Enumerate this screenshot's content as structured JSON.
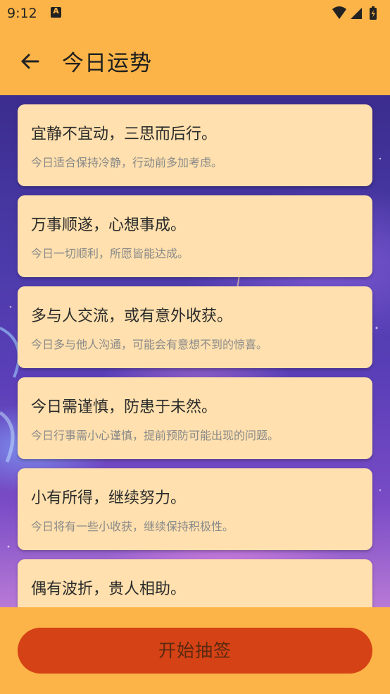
{
  "status_bar": {
    "time": "9:12"
  },
  "header": {
    "title": "今日运势"
  },
  "fortunes": [
    {
      "title": "宜静不宜动，三思而后行。",
      "desc": "今日适合保持冷静，行动前多加考虑。"
    },
    {
      "title": "万事顺遂，心想事成。",
      "desc": "今日一切顺利，所愿皆能达成。"
    },
    {
      "title": "多与人交流，或有意外收获。",
      "desc": "今日多与他人沟通，可能会有意想不到的惊喜。"
    },
    {
      "title": "今日需谨慎，防患于未然。",
      "desc": "今日行事需小心谨慎，提前预防可能出现的问题。"
    },
    {
      "title": "小有所得，继续努力。",
      "desc": "今日将有一些小收获，继续保持积极性。"
    },
    {
      "title": "偶有波折，贵人相助。",
      "desc": ""
    }
  ],
  "actions": {
    "start_label": "开始抽签"
  },
  "colors": {
    "accent": "#fcb448",
    "card": "#ffe0ae",
    "button": "#d54215",
    "button_text": "#5a2a10"
  }
}
